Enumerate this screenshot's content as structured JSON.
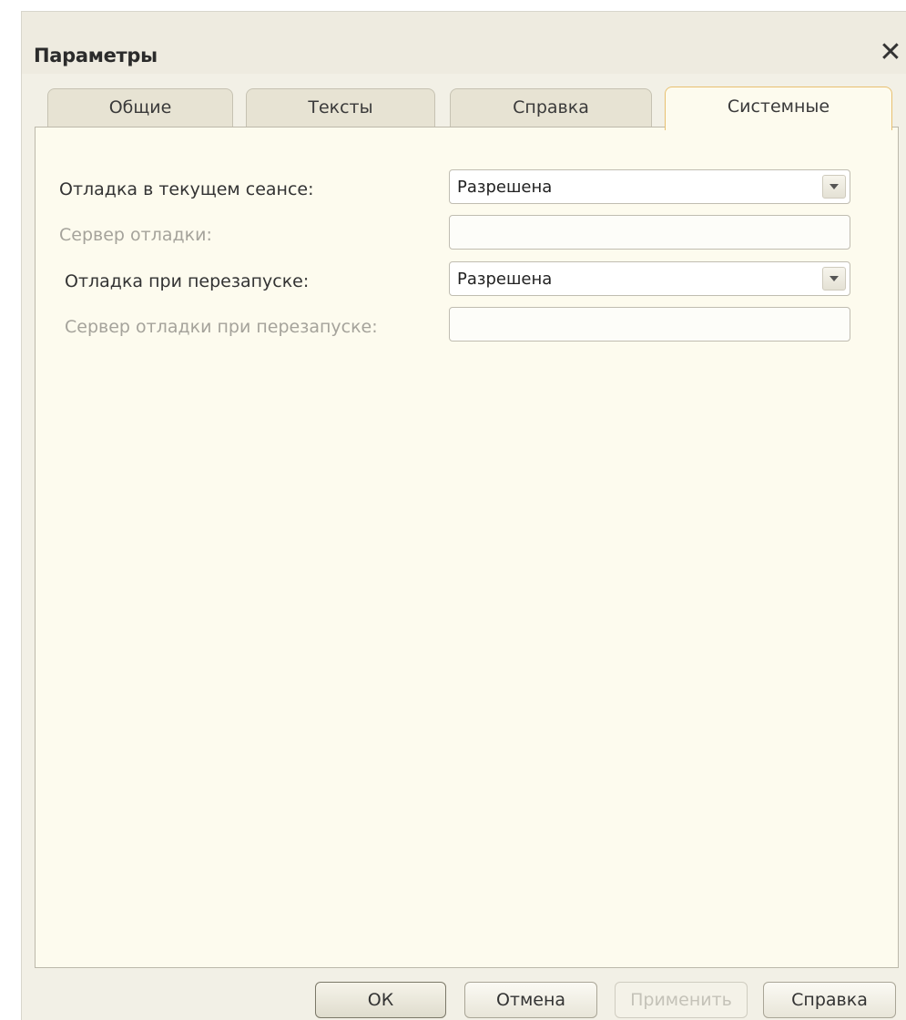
{
  "window": {
    "title": "Параметры"
  },
  "tabs": [
    {
      "label": "Общие",
      "active": false
    },
    {
      "label": "Тексты",
      "active": false
    },
    {
      "label": "Справка",
      "active": false
    },
    {
      "label": "Системные",
      "active": true
    }
  ],
  "fields": {
    "debug_session": {
      "label": "Отладка в текущем сеансе:",
      "value": "Разрешена"
    },
    "debug_server": {
      "label": "Сервер отладки:",
      "value": ""
    },
    "debug_restart": {
      "label": "Отладка при перезапуске:",
      "value": "Разрешена"
    },
    "debug_restart_server": {
      "label": "Сервер отладки при перезапуске:",
      "value": ""
    }
  },
  "buttons": {
    "ok": "ОК",
    "cancel": "Отмена",
    "apply": "Применить",
    "help": "Справка"
  },
  "icons": {
    "close": "close-icon",
    "dropdown": "chevron-down-icon"
  },
  "colors": {
    "panel_bg": "#fdfbee",
    "active_tab_border": "#e8c070",
    "disabled_text": "#a5a39b"
  }
}
